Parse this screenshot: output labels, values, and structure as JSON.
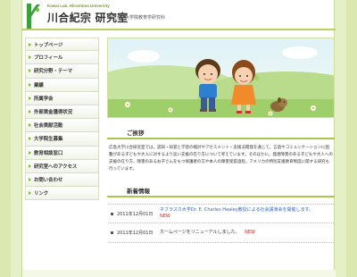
{
  "header": {
    "lab_en": "Kawai Lab. Hiroshima University",
    "title": "川合紀宗 研究室",
    "subtitle": "広島大学大学院教育学研究科"
  },
  "sidebar": {
    "items": [
      {
        "label": "トップページ"
      },
      {
        "label": "プロフィール"
      },
      {
        "label": "研究分野・テーマ"
      },
      {
        "label": "業績"
      },
      {
        "label": "所属学会"
      },
      {
        "label": "外部資金獲得状況"
      },
      {
        "label": "社会貢献活動"
      },
      {
        "label": "大学院生募集"
      },
      {
        "label": "教育相談窓口"
      },
      {
        "label": "研究室へのアクセス"
      },
      {
        "label": "お問い合わせ"
      },
      {
        "label": "リンク"
      }
    ]
  },
  "sections": {
    "greeting_title": "ご挨拶",
    "greeting_text": "広島大学川合研究室では，認知・知覚と学習の検討やアセスメント・支援法開発を通じて，言語やコミュニケーションに困難がある子どもや大人に対するより良い支援の在り方について考えています。そのほかに，発達障害のある子どもや大人への支援の在り方，障害のあるお子さんをもつ保護者の方や本人の障害受容過程，アメリカの特別支援教育制度に関する研究も行っています。",
    "news_title": "新着情報"
  },
  "news": [
    {
      "date": "2011年12月01日",
      "text": "ネブラスカ大学Dr. E. Charles Healey教授による社会講演会を開催します。",
      "badge": "NEW"
    },
    {
      "date": "2011年12月01日",
      "text": "ホームページをリニューアルしました。",
      "badge": "NEW"
    }
  ],
  "colors": {
    "accent_green": "#a6c84a",
    "background": "#e6f0c6",
    "new_red": "#e02020",
    "link_blue": "#3366bb"
  }
}
